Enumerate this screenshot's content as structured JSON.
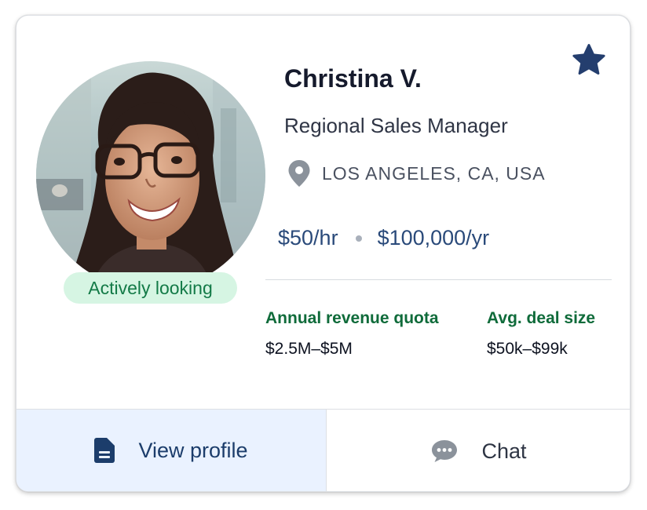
{
  "candidate": {
    "name": "Christina V.",
    "title": "Regional Sales Manager",
    "location": "LOS ANGELES, CA, USA",
    "status": "Actively looking",
    "hourly_rate": "$50/hr",
    "annual_rate": "$100,000/yr"
  },
  "metrics": [
    {
      "label": "Annual revenue quota",
      "value": "$2.5M–$5M"
    },
    {
      "label": "Avg. deal size",
      "value": "$50k–$99k"
    }
  ],
  "actions": {
    "view_profile": "View profile",
    "chat": "Chat"
  },
  "icons": {
    "favorite": "star-icon",
    "location": "map-pin-icon",
    "profile": "document-icon",
    "chat": "chat-bubble-icon"
  },
  "colors": {
    "star": "#243e6e",
    "status_bg": "#d6f5e3",
    "status_text": "#137a47",
    "metric_label": "#0f6b3a",
    "rate_text": "#2a4a7a",
    "view_button_bg": "#eaf2ff"
  }
}
